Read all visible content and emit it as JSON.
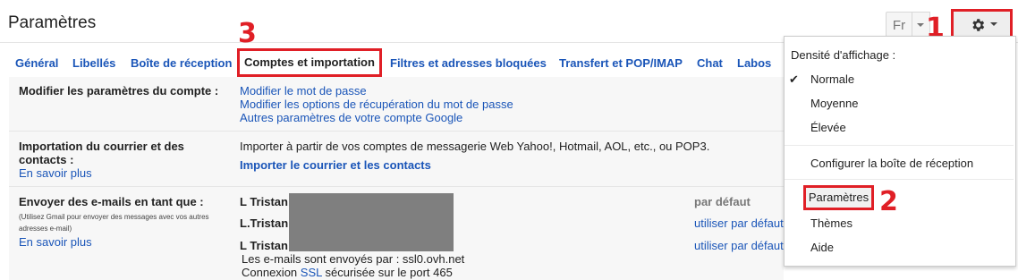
{
  "header": {
    "title": "Paramètres",
    "language_button": "Fr"
  },
  "annotations": {
    "one": "1",
    "two": "2",
    "three": "3"
  },
  "tabs": [
    {
      "label": "Général"
    },
    {
      "label": "Libellés"
    },
    {
      "label": "Boîte de réception"
    },
    {
      "label": "Comptes et importation"
    },
    {
      "label": "Filtres et adresses bloquées"
    },
    {
      "label": "Transfert et POP/IMAP"
    },
    {
      "label": "Chat"
    },
    {
      "label": "Labos"
    }
  ],
  "sections": {
    "account": {
      "label": "Modifier les paramètres du compte :",
      "links": [
        "Modifier le mot de passe",
        "Modifier les options de récupération du mot de passe",
        "Autres paramètres de votre compte Google"
      ]
    },
    "import": {
      "label_line1": "Importation du courrier et des",
      "label_line2": "contacts :",
      "learn_more": "En savoir plus",
      "description": "Importer à partir de vos comptes de messagerie Web Yahoo!, Hotmail, AOL, etc., ou POP3.",
      "action": "Importer le courrier et les contacts"
    },
    "send_as": {
      "label": "Envoyer des e-mails en tant que :",
      "note_line1": "(Utilisez Gmail pour envoyer des messages avec vos autres",
      "note_line2": "adresses e-mail)",
      "learn_more": "En savoir plus",
      "names": [
        "L Tristan",
        "L.Tristan",
        "L Tristan"
      ],
      "default_label": "par défaut",
      "make_default": [
        "utiliser par défaut",
        "utiliser par défaut"
      ],
      "smtp_text": "Les e-mails sont envoyés par : ssl0.ovh.net",
      "conn_prefix": "Connexion ",
      "conn_ssl": "SSL",
      "conn_suffix": " sécurisée sur le port 465"
    }
  },
  "menu": {
    "density_header": "Densité d'affichage :",
    "check_mark": "✔",
    "density_options": [
      "Normale",
      "Moyenne",
      "Élevée"
    ],
    "configure": "Configurer la boîte de réception",
    "settings": "Paramètres",
    "themes": "Thèmes",
    "help": "Aide"
  },
  "colors": {
    "link": "#1a55b8",
    "annotation_red": "#e01f26"
  }
}
